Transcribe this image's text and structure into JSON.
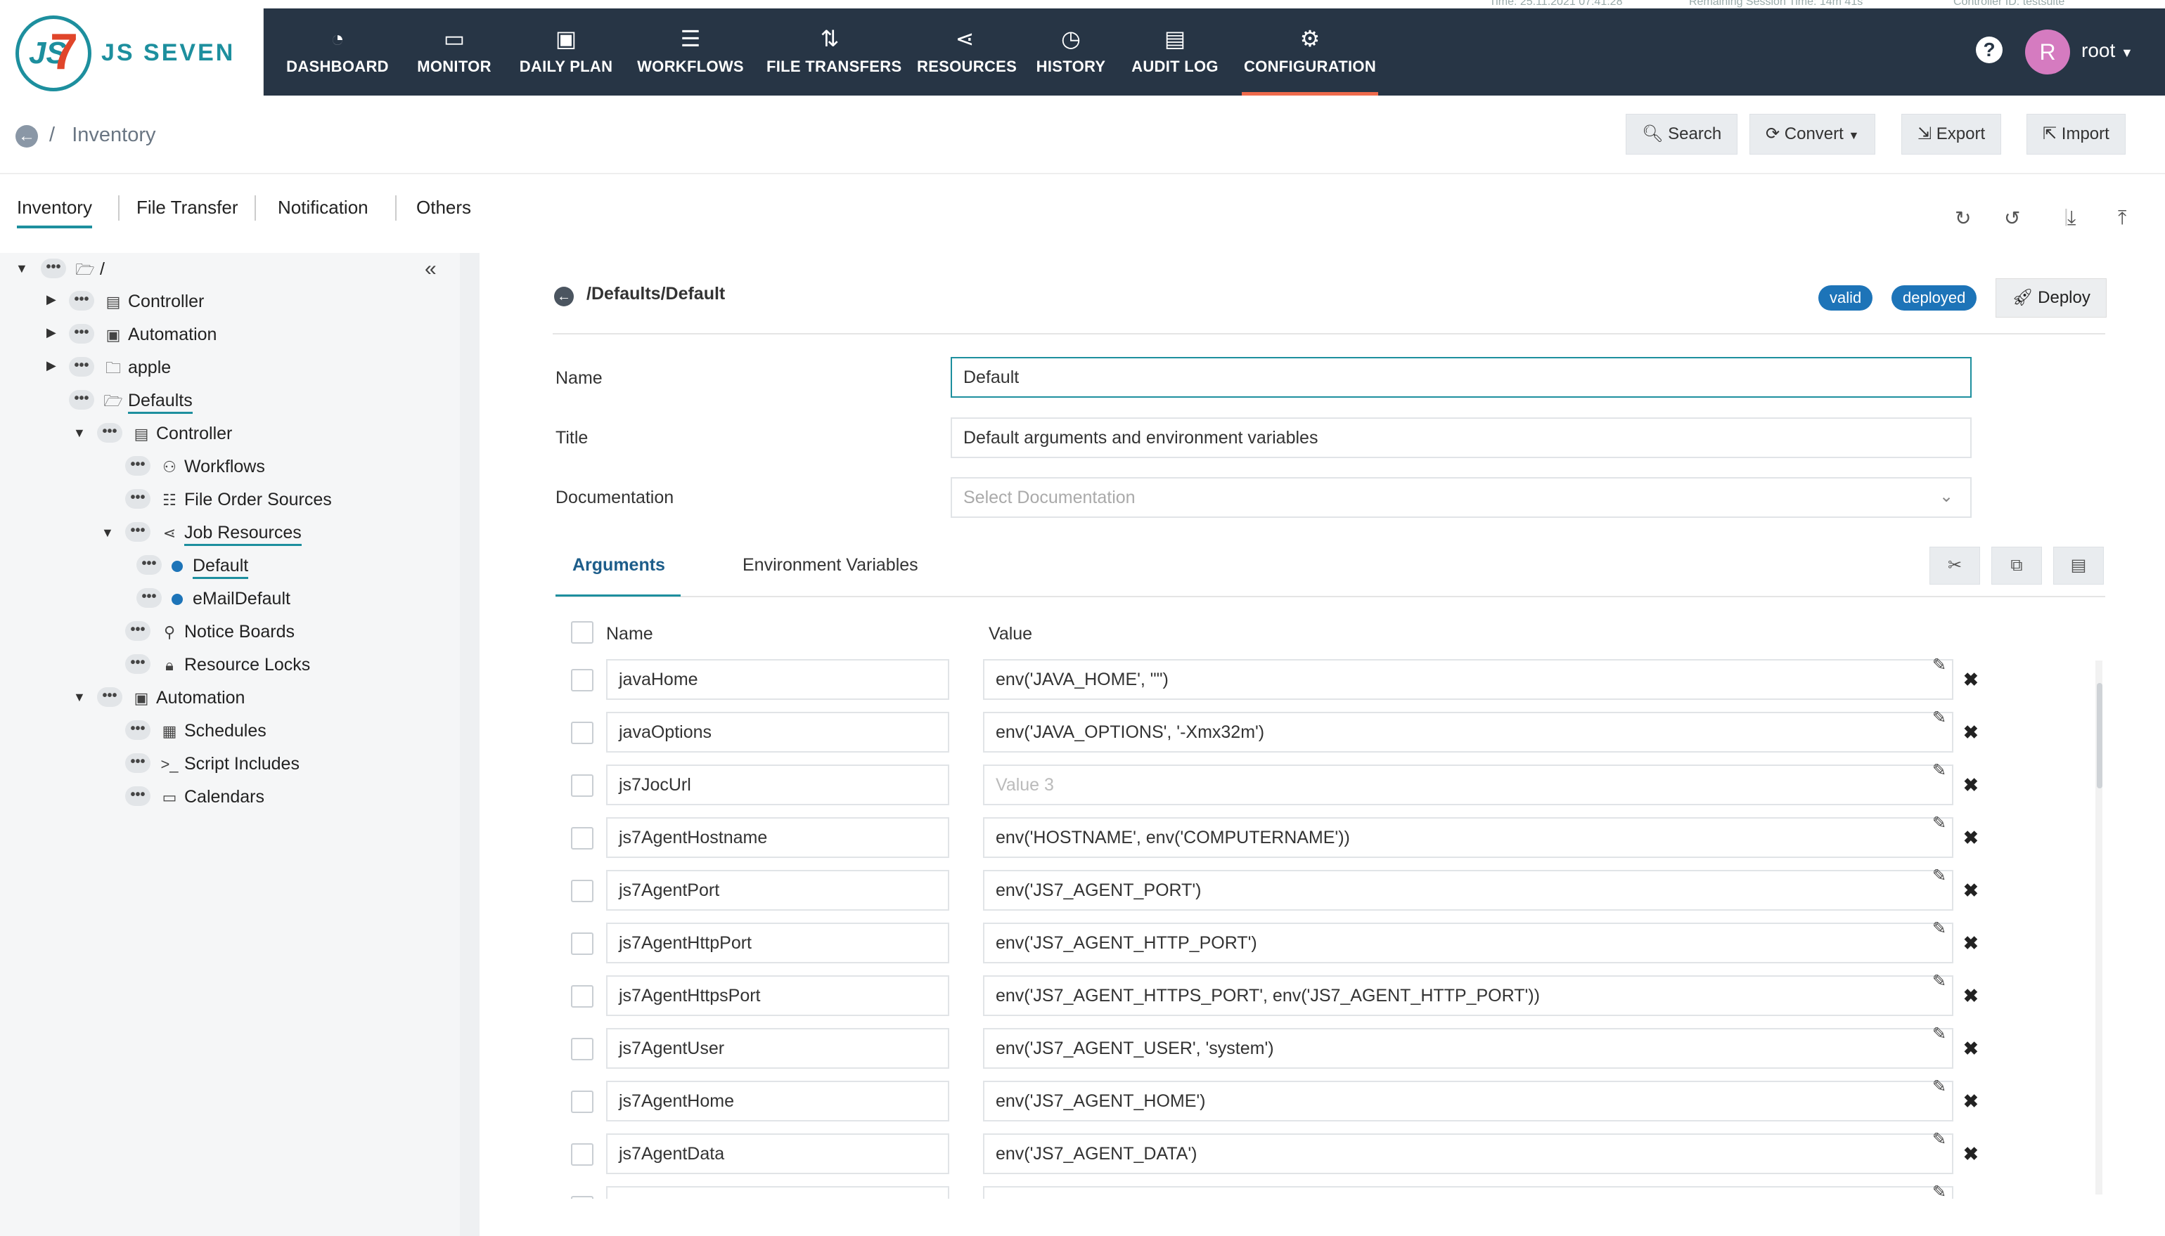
{
  "topbar": {
    "time": "Time: 25.11.2021 07:41:28",
    "session": "Remaining Session Time: 14m 41s",
    "controller": "Controller ID: testsuite"
  },
  "logo": {
    "text": "JS SEVEN",
    "mark": "JS7"
  },
  "nav": [
    {
      "label": "DASHBOARD",
      "icon": "dashboard-icon"
    },
    {
      "label": "MONITOR",
      "icon": "monitor-icon"
    },
    {
      "label": "DAILY PLAN",
      "icon": "calendar-clock-icon"
    },
    {
      "label": "WORKFLOWS",
      "icon": "workflow-icon"
    },
    {
      "label": "FILE TRANSFERS",
      "icon": "transfer-icon"
    },
    {
      "label": "RESOURCES",
      "icon": "share-icon"
    },
    {
      "label": "HISTORY",
      "icon": "alarm-clock-icon"
    },
    {
      "label": "AUDIT LOG",
      "icon": "audit-icon"
    },
    {
      "label": "CONFIGURATION",
      "icon": "gear-icon",
      "active": true
    }
  ],
  "header_right": {
    "avatar_letter": "R",
    "user": "root",
    "help_icon": "?"
  },
  "breadcrumb": {
    "sep": "/",
    "current": "Inventory"
  },
  "toolbar": {
    "search": "Search",
    "convert": "Convert",
    "export": "Export",
    "import": "Import"
  },
  "subtabs": [
    "Inventory",
    "File Transfer",
    "Notification",
    "Others"
  ],
  "tree": {
    "root": "/",
    "controller": "Controller",
    "automation": "Automation",
    "apple": "apple",
    "defaults": "Defaults",
    "d_controller": "Controller",
    "workflows": "Workflows",
    "file_order_sources": "File Order Sources",
    "job_resources": "Job Resources",
    "default": "Default",
    "emaildefault": "eMailDefault",
    "notice_boards": "Notice Boards",
    "resource_locks": "Resource Locks",
    "d_automation": "Automation",
    "schedules": "Schedules",
    "script_includes": "Script Includes",
    "calendars": "Calendars"
  },
  "detail": {
    "path": "/Defaults/Default",
    "badge_valid": "valid",
    "badge_deployed": "deployed",
    "deploy": "Deploy",
    "name_label": "Name",
    "name_value": "Default",
    "title_label": "Title",
    "title_value": "Default arguments and environment variables",
    "doc_label": "Documentation",
    "doc_placeholder": "Select Documentation",
    "tab_arguments": "Arguments",
    "tab_env": "Environment Variables",
    "col_name": "Name",
    "col_value": "Value"
  },
  "arguments": [
    {
      "name": "javaHome",
      "value": "env('JAVA_HOME', \"\")"
    },
    {
      "name": "javaOptions",
      "value": "env('JAVA_OPTIONS', '-Xmx32m')"
    },
    {
      "name": "js7JocUrl",
      "value": "",
      "placeholder": "Value 3"
    },
    {
      "name": "js7AgentHostname",
      "value": "env('HOSTNAME', env('COMPUTERNAME'))"
    },
    {
      "name": "js7AgentPort",
      "value": "env('JS7_AGENT_PORT')"
    },
    {
      "name": "js7AgentHttpPort",
      "value": "env('JS7_AGENT_HTTP_PORT')"
    },
    {
      "name": "js7AgentHttpsPort",
      "value": "env('JS7_AGENT_HTTPS_PORT', env('JS7_AGENT_HTTP_PORT'))"
    },
    {
      "name": "js7AgentUser",
      "value": "env('JS7_AGENT_USER', 'system')"
    },
    {
      "name": "js7AgentHome",
      "value": "env('JS7_AGENT_HOME')"
    },
    {
      "name": "js7AgentData",
      "value": "env('JS7_AGENT_DATA')"
    },
    {
      "name": "",
      "value": ""
    }
  ],
  "colors": {
    "navbar": "#273545",
    "accent": "#1d8f9e",
    "badge": "#1d74b8",
    "active_underline": "#ef6a4c"
  }
}
